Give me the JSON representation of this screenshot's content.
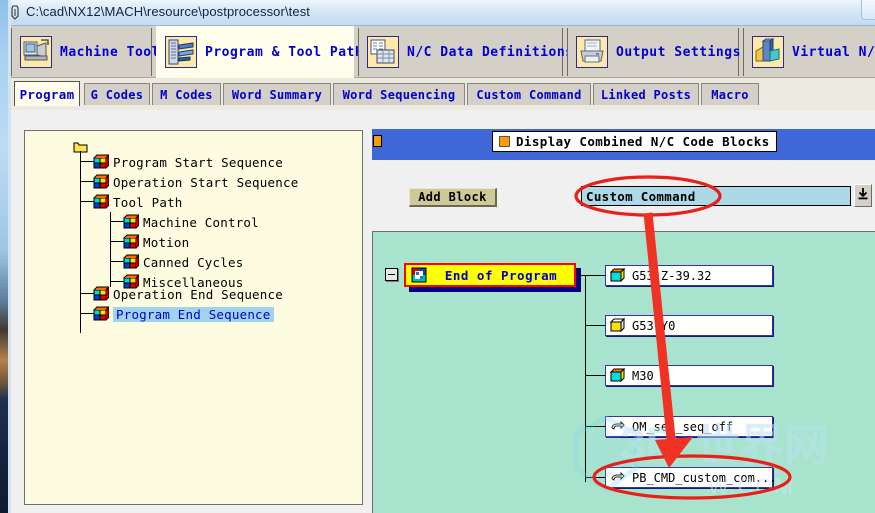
{
  "titlebar": {
    "path": "C:\\cad\\NX12\\MACH\\resource\\postprocessor\\test",
    "pin_icon": "pin-icon"
  },
  "main_tabs": [
    {
      "label": "Machine Tool",
      "icon": "machine-tool-icon",
      "active": false
    },
    {
      "label": "Program & Tool Path",
      "icon": "program-tool-path-icon",
      "active": true
    },
    {
      "label": "N/C Data Definitions",
      "icon": "nc-data-definitions-icon",
      "active": false
    },
    {
      "label": "Output Settings",
      "icon": "printer-icon",
      "active": false
    },
    {
      "label": "Virtual N/C",
      "icon": "virtual-nc-icon",
      "active": false
    }
  ],
  "sub_tabs": [
    {
      "label": "Program",
      "active": true
    },
    {
      "label": "G Codes",
      "active": false
    },
    {
      "label": "M Codes",
      "active": false
    },
    {
      "label": "Word Summary",
      "active": false
    },
    {
      "label": "Word Sequencing",
      "active": false
    },
    {
      "label": "Custom Command",
      "active": false
    },
    {
      "label": "Linked Posts",
      "active": false
    },
    {
      "label": "Macro",
      "active": false
    }
  ],
  "tree": {
    "root_icon": "folder-icon",
    "nodes": [
      {
        "label": "Program Start Sequence",
        "selected": false,
        "depth": 0
      },
      {
        "label": "Operation Start Sequence",
        "selected": false,
        "depth": 0
      },
      {
        "label": "Tool Path",
        "selected": false,
        "depth": 0
      },
      {
        "label": "Machine Control",
        "selected": false,
        "depth": 1
      },
      {
        "label": "Motion",
        "selected": false,
        "depth": 1
      },
      {
        "label": "Canned Cycles",
        "selected": false,
        "depth": 1
      },
      {
        "label": "Miscellaneous",
        "selected": false,
        "depth": 1
      },
      {
        "label": "Operation End Sequence",
        "selected": false,
        "depth": 0
      },
      {
        "label": "Program End Sequence",
        "selected": true,
        "depth": 0
      }
    ]
  },
  "right_panel": {
    "display_combined_label": "Display Combined N/C Code Blocks",
    "display_combined_checkbox_color": "#ff9b00",
    "add_block_label": "Add Block",
    "combo_value": "Custom Command",
    "combo_dropdown_icon": "download-arrow-icon",
    "header_color": "#3f67d8"
  },
  "canvas": {
    "background_color": "#a8e3ce",
    "parent_block": {
      "label": "End of Program",
      "icon": "puzzle-icon",
      "highlight_border": "#ff0000",
      "fill": "#ffff00"
    },
    "child_blocks": [
      {
        "label": "G53 Z-39.32",
        "icon": "cyan-cube-icon"
      },
      {
        "label": "G53 Y0",
        "icon": "yellow-cube-icon"
      },
      {
        "label": "M30",
        "icon": "cyan-cube-icon"
      },
      {
        "label": "OM_set_seq_off",
        "icon": "hand-pointer-icon"
      },
      {
        "label": "PB_CMD_custom_com...",
        "icon": "hand-pointer-icon"
      }
    ]
  },
  "annotations": {
    "ellipse_combo": "red-ellipse-highlight",
    "ellipse_block": "red-ellipse-highlight",
    "arrow": "red-arrow"
  },
  "watermark": {
    "text": "3D世界网",
    "sub_text": "W.COM"
  }
}
